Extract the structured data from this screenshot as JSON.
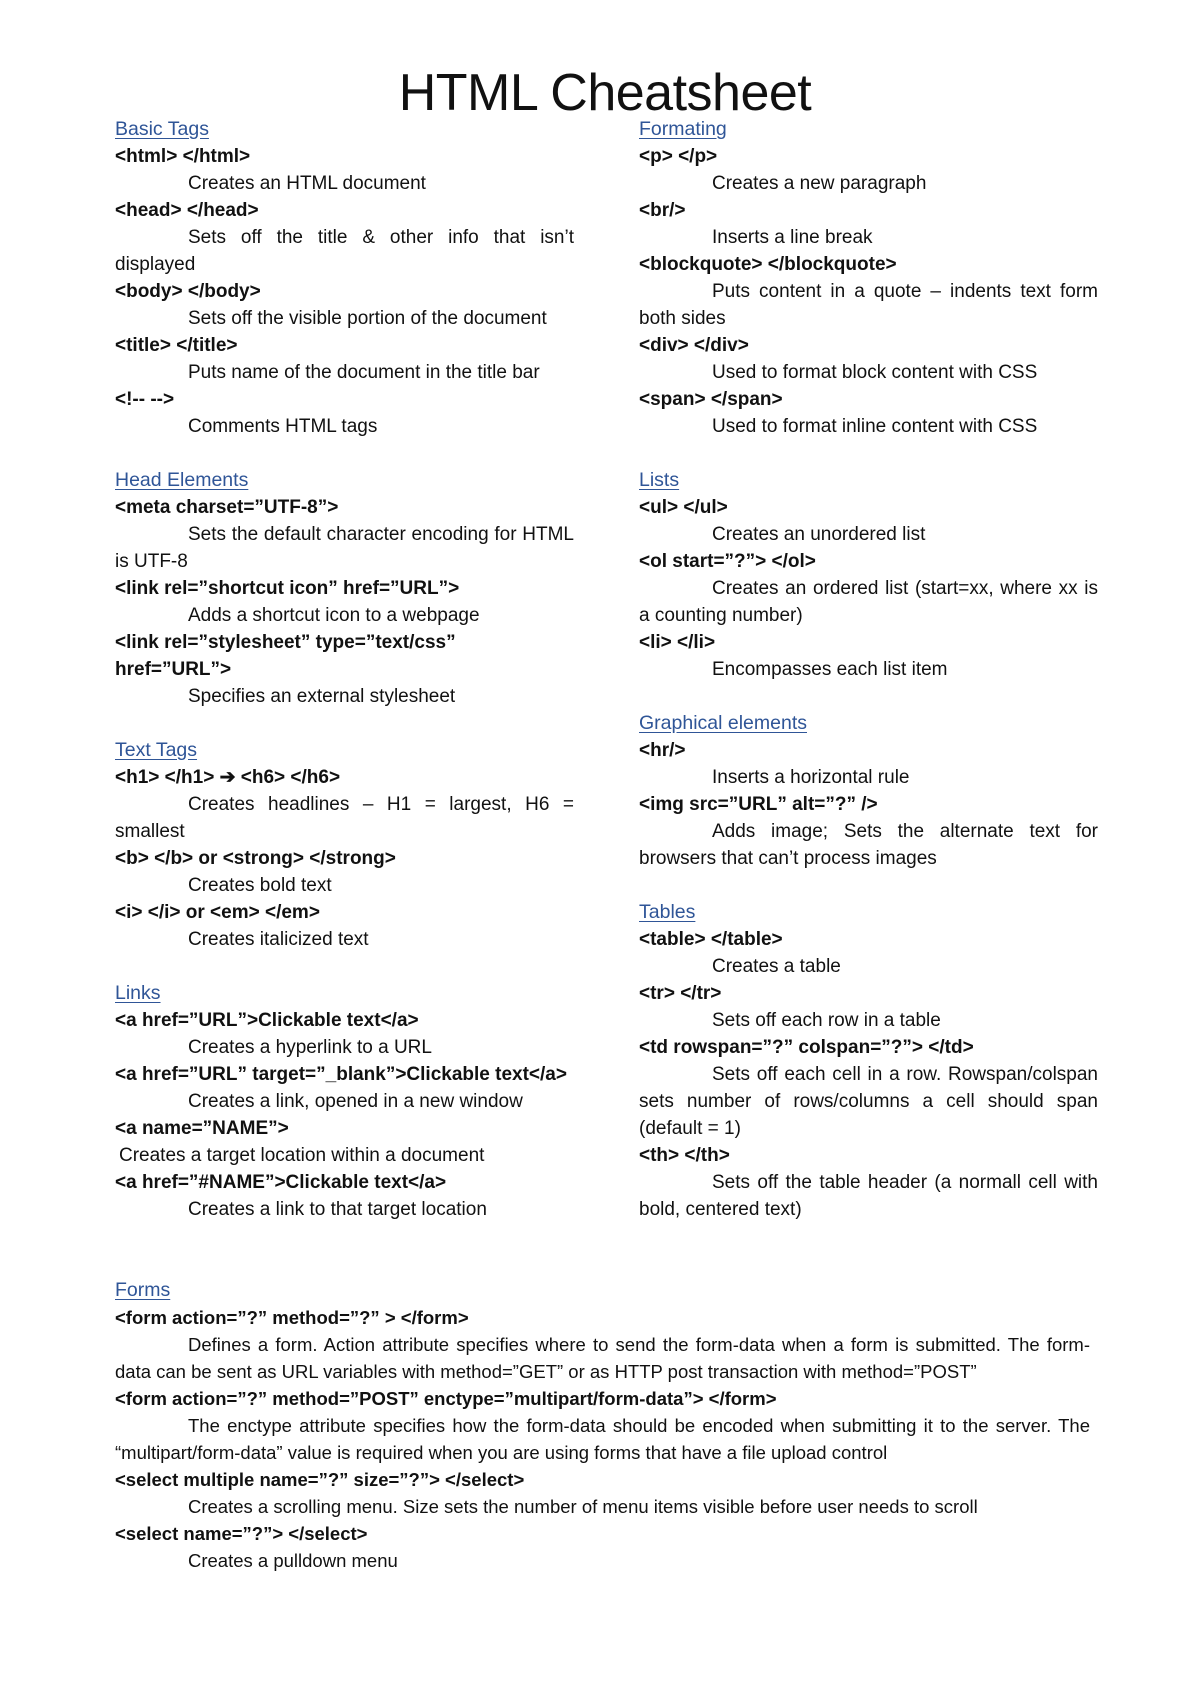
{
  "title": "HTML Cheatsheet",
  "colors": {
    "heading": "#2f5597",
    "text": "#111111"
  },
  "left_column": [
    {
      "heading": "Basic Tags",
      "entries": [
        {
          "tag": "<html> </html>",
          "desc": "Creates an HTML document"
        },
        {
          "tag": "<head> </head>",
          "desc": "Sets off the title & other info that isn’t displayed"
        },
        {
          "tag": "<body> </body>",
          "desc": "Sets off the visible portion of the document"
        },
        {
          "tag": "<title> </title>",
          "desc": "Puts name of the document in the title bar"
        },
        {
          "tag": "<!-- -->",
          "desc": "Comments HTML tags"
        }
      ]
    },
    {
      "heading": "Head Elements",
      "entries": [
        {
          "tag": "<meta charset=”UTF-8”>",
          "desc": "Sets the default character encoding for HTML is UTF-8"
        },
        {
          "tag": "<link rel=”shortcut icon” href=”URL”>",
          "desc": "Adds a shortcut icon to a webpage"
        },
        {
          "tag": "<link rel=”stylesheet” type=”text/css” href=”URL”>",
          "desc": "Specifies an external stylesheet"
        }
      ]
    },
    {
      "heading": "Text Tags",
      "entries": [
        {
          "tag": "<h1> </h1> ➔ <h6> </h6>",
          "desc": "Creates headlines – H1 = largest, H6 = smallest"
        },
        {
          "tag": "<b> </b> or <strong> </strong>",
          "desc": "Creates bold text"
        },
        {
          "tag": "<i> </i> or <em> </em>",
          "desc": "Creates italicized text"
        }
      ]
    },
    {
      "heading": "Links",
      "entries": [
        {
          "tag": "<a href=”URL”>Clickable text</a>",
          "desc": "Creates a hyperlink to a URL"
        },
        {
          "tag": "<a href=”URL” target=”_blank”>Clickable text</a>",
          "desc": "Creates a link, opened in a new window"
        },
        {
          "tag": "<a name=”NAME”>",
          "desc": "Creates a target location within a document",
          "noindent": true
        },
        {
          "tag": "<a href=”#NAME”>Clickable text</a>",
          "desc": "Creates a link to that target location"
        }
      ]
    }
  ],
  "right_column": [
    {
      "heading": "Formating",
      "entries": [
        {
          "tag": "<p> </p>",
          "desc": "Creates a new paragraph"
        },
        {
          "tag": "<br/>",
          "desc": "Inserts a line break"
        },
        {
          "tag": "<blockquote> </blockquote>",
          "desc": "Puts content in a quote – indents text form both sides"
        },
        {
          "tag": "<div> </div>",
          "desc": "Used to format block content with CSS"
        },
        {
          "tag": "<span> </span>",
          "desc": "Used to format inline content with CSS"
        }
      ]
    },
    {
      "heading": "Lists",
      "entries": [
        {
          "tag": "<ul> </ul>",
          "desc": "Creates an unordered list"
        },
        {
          "tag": "<ol start=”?”> </ol>",
          "desc": "Creates an ordered list (start=xx, where xx is a counting number)"
        },
        {
          "tag": "<li> </li>",
          "desc": "Encompasses each list item"
        }
      ]
    },
    {
      "heading": "Graphical elements",
      "entries": [
        {
          "tag": "<hr/>",
          "desc": "Inserts a horizontal rule"
        },
        {
          "tag": "<img src=”URL” alt=”?” />",
          "desc": "Adds image; Sets the alternate text for browsers that can’t process images"
        }
      ]
    },
    {
      "heading": "Tables",
      "entries": [
        {
          "tag": "<table> </table>",
          "desc": "Creates a table"
        },
        {
          "tag": "<tr> </tr>",
          "desc": "Sets off each row in a table"
        },
        {
          "tag": "<td rowspan=”?” colspan=”?”> </td>",
          "desc": "Sets off each cell in a row. Rowspan/colspan sets number of rows/columns a cell should span (default = 1)"
        },
        {
          "tag": "<th> </th>",
          "desc": "Sets off the table header (a normall cell with bold, centered text)"
        }
      ]
    }
  ],
  "full_width": [
    {
      "heading": "Forms",
      "entries": [
        {
          "tag": "<form action=”?” method=”?” > </form>",
          "desc": "Defines a form. Action attribute specifies where to send the form-data when a form is submitted. The form-data can be sent as URL variables with method=”GET” or as HTTP post transaction with method=”POST”"
        },
        {
          "tag": "<form action=”?” method=”POST” enctype=”multipart/form-data”> </form>",
          "desc": "The enctype attribute specifies how the form-data should be encoded when submitting it to the server. The “multipart/form-data” value is required when you are using forms that have a file upload control"
        },
        {
          "tag": "<select multiple name=”?” size=”?”> </select>",
          "desc": "Creates a scrolling menu. Size sets the number of menu items visible before user needs to scroll"
        },
        {
          "tag": "<select name=”?”> </select>",
          "desc": "Creates a pulldown menu"
        }
      ]
    }
  ]
}
